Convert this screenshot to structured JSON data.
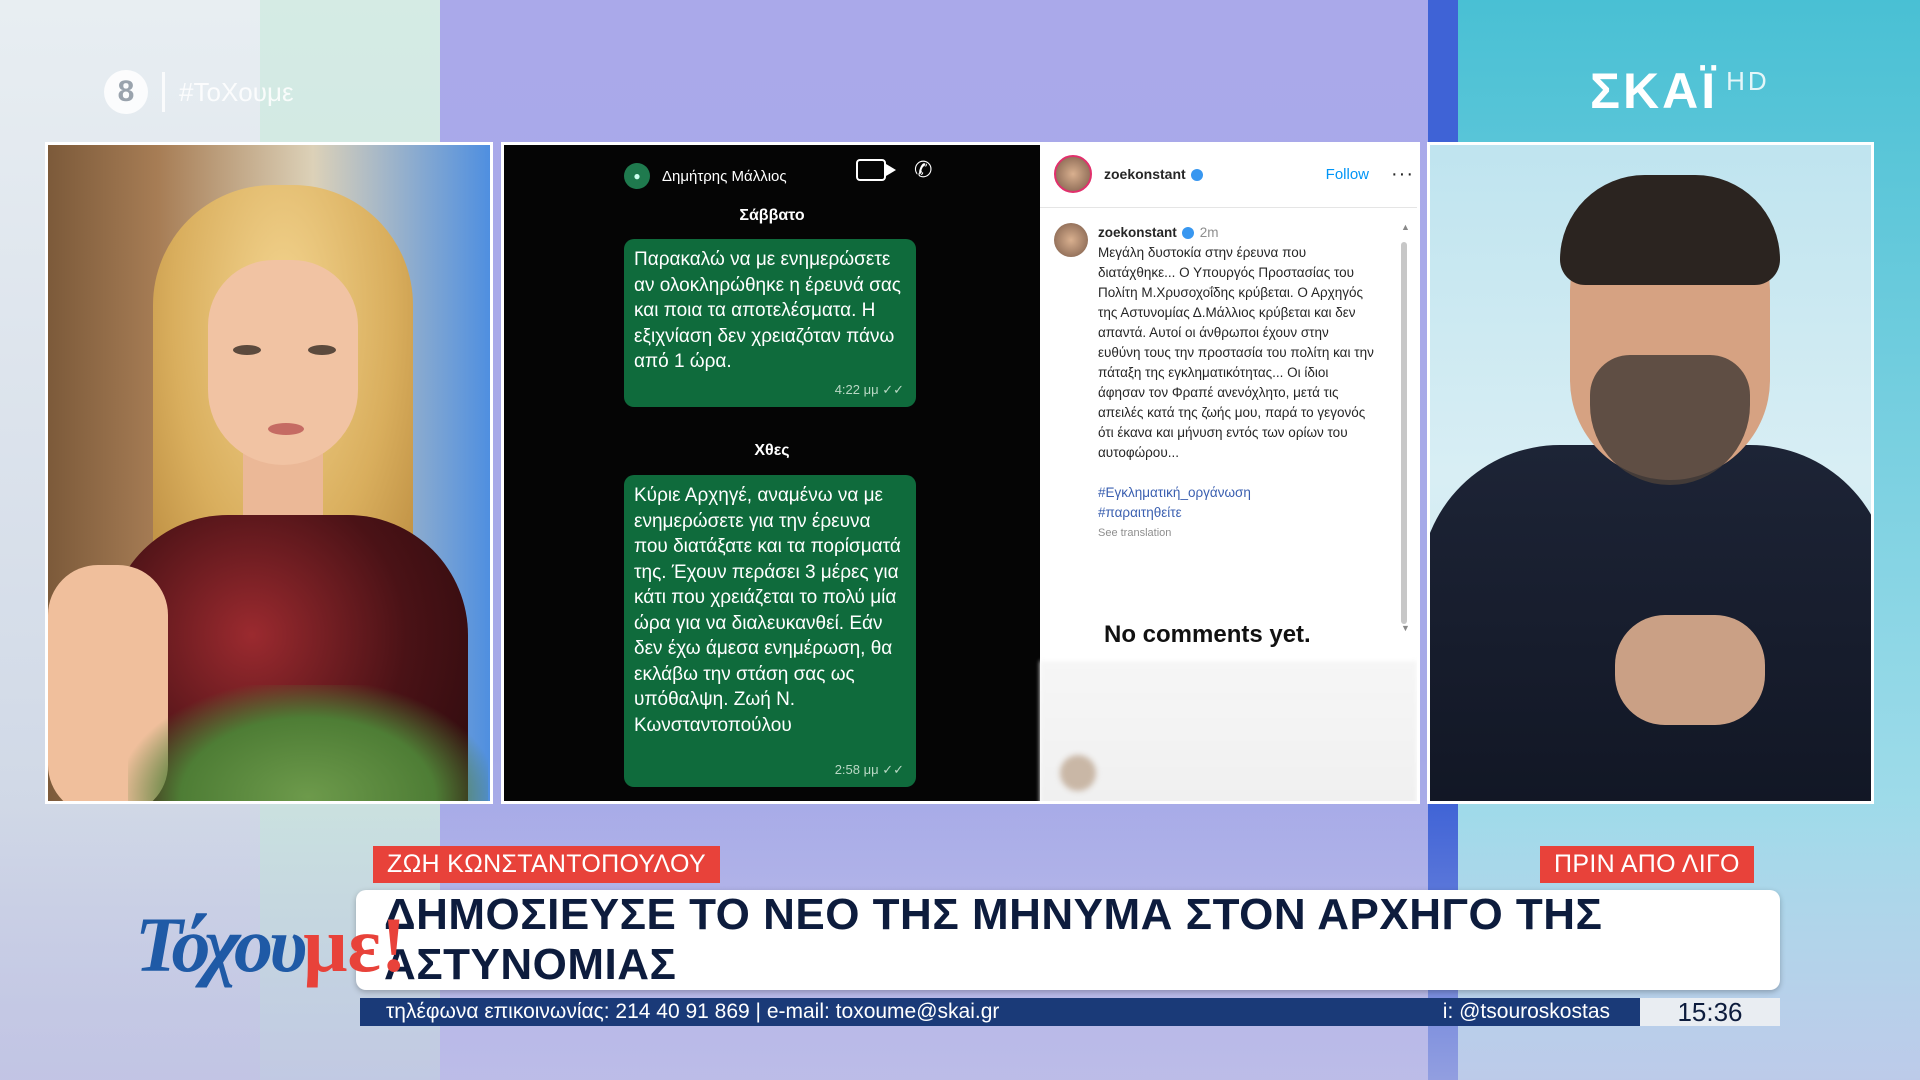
{
  "channel": {
    "logo_number": "8",
    "hashtag": "#ΤοΧουμε",
    "network": "ΣΚΑΪ",
    "network_suffix": "HD"
  },
  "whatsapp": {
    "contact_name": "Δημήτρης Μάλλιος",
    "icons": [
      "video-camera-icon",
      "phone-icon"
    ],
    "messages": [
      {
        "day": "Σάββατο",
        "text": "Παρακαλώ να με ενημερώσετε αν ολοκληρώθηκε η έρευνά σας και ποια τα αποτελέσματα. Η εξιχνίαση δεν χρειαζόταν πάνω από 1 ώρα.",
        "time": "4:22 μμ ✓✓"
      },
      {
        "day": "Χθες",
        "text": "Κύριε Αρχηγέ, αναμένω να με ενημερώσετε για την έρευνα που διατάξατε και τα πορίσματά της. Έχουν περάσει 3 μέρες για κάτι που χρειάζεται το πολύ μία ώρα για να διαλευκανθεί. Εάν δεν έχω άμεσα ενημέρωση, θα εκλάβω την στάση σας ως υπόθαλψη. Ζωή Ν. Κωνσταντοπούλου",
        "time": "2:58 μμ ✓✓"
      }
    ]
  },
  "instagram": {
    "username": "zoekonstant",
    "follow_label": "Follow",
    "more_label": "···",
    "post_age": "2m",
    "caption": "Μεγάλη δυστοκία στην έρευνα που διατάχθηκε... Ο Υπουργός Προστασίας του Πολίτη Μ.Χρυσοχοΐδης κρύβεται. Ο Αρχηγός της Αστυνομίας Δ.Μάλλιος κρύβεται και δεν απαντά. Αυτοί οι άνθρωποι έχουν στην ευθύνη τους την προστασία του πολίτη και την πάταξη της εγκληματικότητας... Οι ίδιοι άφησαν τον Φραπέ ανενόχλητο, μετά τις απειλές κατά της ζωής μου, παρά το γεγονός ότι έκανα και μήνυση εντός των ορίων του αυτοφώρου...",
    "hashtags": [
      "#Εγκληματική_οργάνωση",
      "#παραιτηθείτε"
    ],
    "see_translation": "See translation",
    "no_comments": "No comments yet."
  },
  "lower_third": {
    "name_tag": "ΖΩΗ ΚΩΝΣΤΑΝΤΟΠΟΥΛΟΥ",
    "time_tag": "ΠΡΙΝ ΑΠΟ ΛΙΓΟ",
    "headline": "ΔΗΜΟΣΙΕΥΣΕ ΤΟ ΝΕΟ ΤΗΣ ΜΗΝΥΜΑ ΣΤΟΝ ΑΡΧΗΓΟ ΤΗΣ ΑΣΤΥΝΟΜΙΑΣ",
    "show_logo_main": "Τόχου",
    "show_logo_accent": "με!",
    "contact_line": "τηλέφωνα επικοινωνίας: 214 40 91 869  |  e-mail: toxoume@skai.gr",
    "social": "i: @tsouroskostas",
    "clock": "15:36"
  },
  "colors": {
    "accent_red": "#e8423a",
    "whatsapp_bubble": "#0f6b3c",
    "ticker_blue": "#1a3a78",
    "headline_text": "#0d1c3d"
  }
}
